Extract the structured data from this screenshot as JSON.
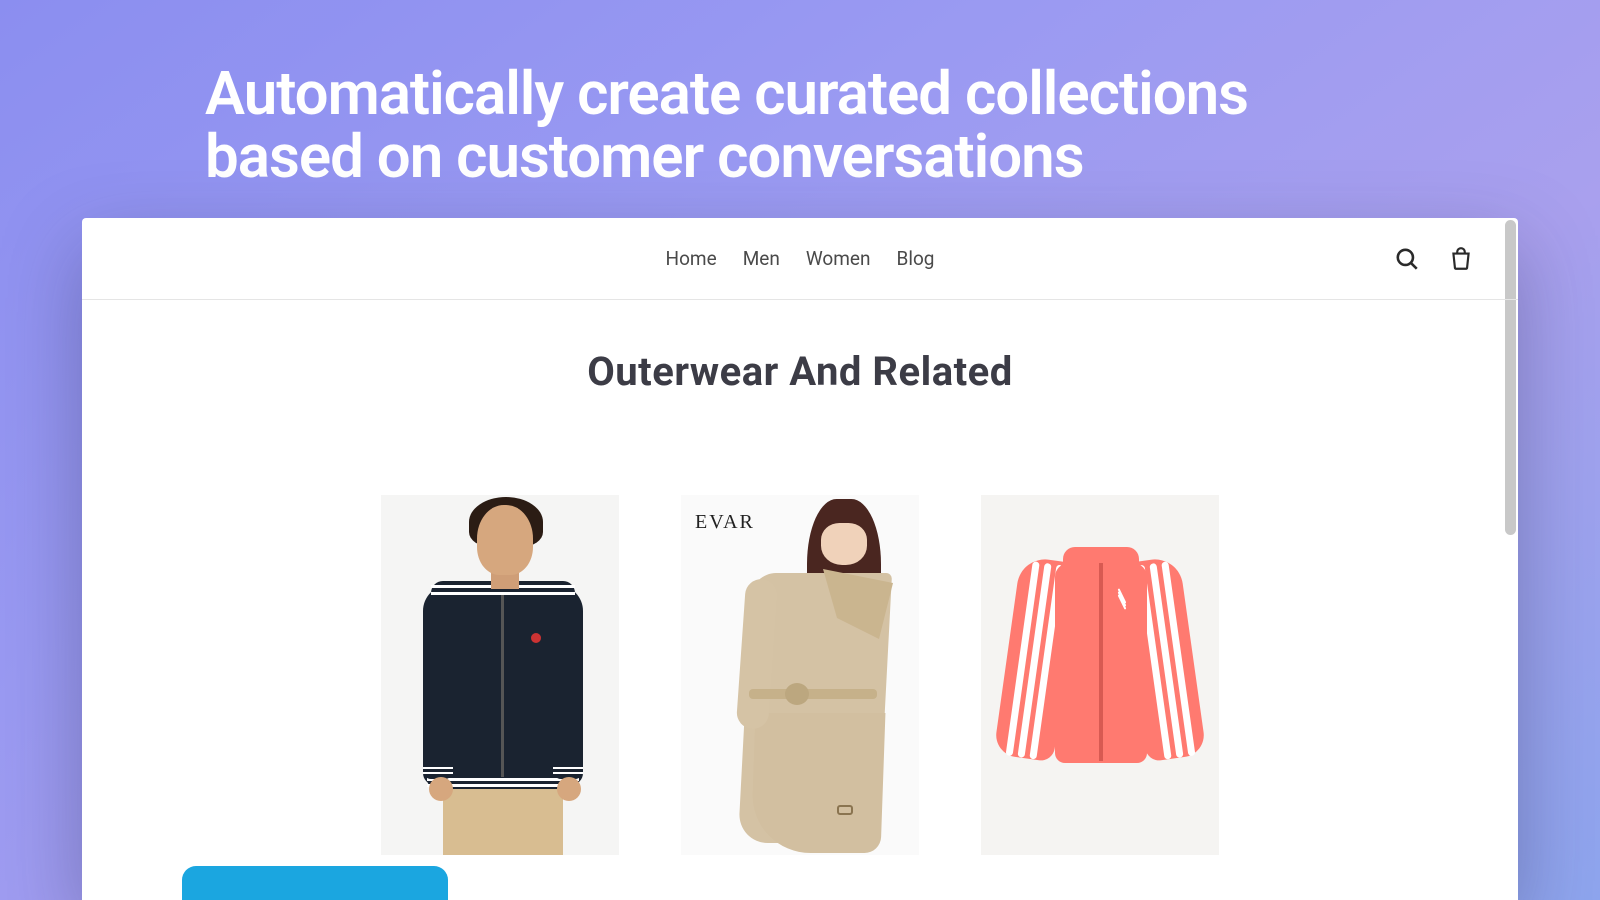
{
  "hero": {
    "line1": "Automatically create curated collections",
    "line2": "based on customer conversations"
  },
  "nav": {
    "items": [
      "Home",
      "Men",
      "Women",
      "Blog"
    ]
  },
  "page": {
    "title": "Outerwear And Related"
  },
  "products": [
    {
      "brand": ""
    },
    {
      "brand": "EVAR"
    },
    {
      "brand": ""
    }
  ]
}
